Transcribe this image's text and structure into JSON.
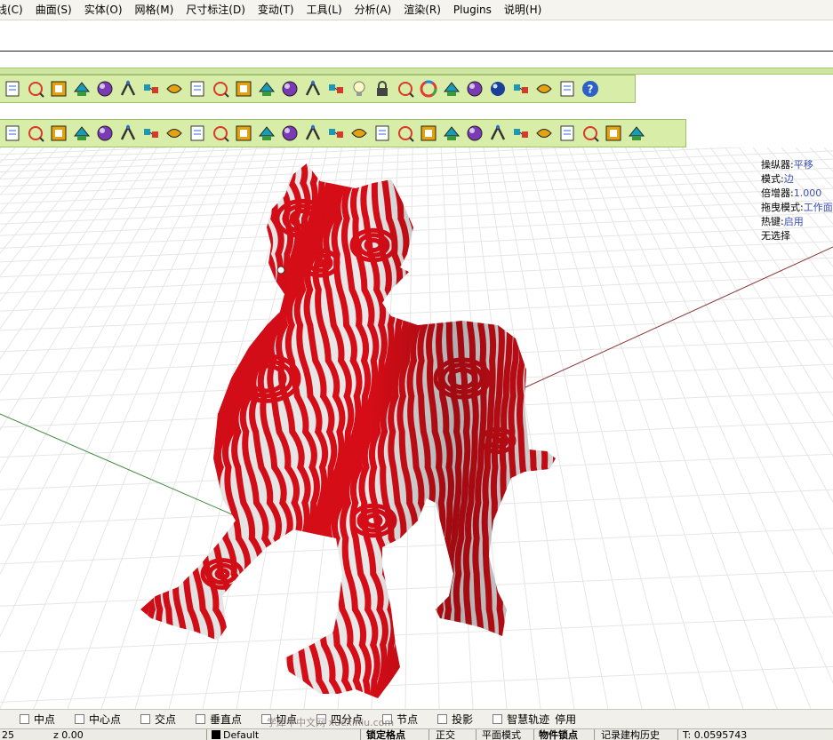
{
  "menu": [
    "线(C)",
    "曲面(S)",
    "实体(O)",
    "网格(M)",
    "尺寸标注(D)",
    "变动(T)",
    "工具(L)",
    "分析(A)",
    "渲染(R)",
    "Plugins",
    "说明(H)"
  ],
  "toolbar1_icons": [
    "document-icon",
    "clipboard-icon",
    "undo-icon",
    "pan-hand-icon",
    "rotate-view-icon",
    "zoom-icon",
    "zoom-window-icon",
    "zoom-extents-icon",
    "zoom-selected-icon",
    "undo-view-icon",
    "four-viewports-icon",
    "car-icon",
    "plane-icon",
    "cplane-icon",
    "origin-icon",
    "light-bulb-icon",
    "lock-icon",
    "layer-icon",
    "color-wheel-icon",
    "sphere-wire-icon",
    "render-sphere-icon",
    "render-ball-icon",
    "flag-icon",
    "gear-icon",
    "hierarchy-icon",
    "help-icon"
  ],
  "toolbar2_icons": [
    "array-icon",
    "grid-points-icon",
    "rotate-obj-icon",
    "polyhedron-icon",
    "flip-icon",
    "twist-icon",
    "arch-icon",
    "bend-icon",
    "extrude-icon",
    "box-split-icon",
    "grid-box-icon",
    "check-box-icon",
    "mirror-icon",
    "grid-x-icon",
    "grid-red-icon",
    "cube-edit-icon",
    "stairs-icon",
    "stairs2-icon",
    "cut-icon",
    "star-tool-icon",
    "surface-icon",
    "contour-icon",
    "flatten-icon",
    "cross-icon",
    "solid-icon",
    "dots-icon",
    "tree-icon",
    "spiral-icon"
  ],
  "osd": [
    {
      "label": "操纵器:",
      "value": "平移"
    },
    {
      "label": "模式:",
      "value": "边"
    },
    {
      "label": "倍增器:",
      "value": "1.000"
    },
    {
      "label": "拖曳模式:",
      "value": "工作面"
    },
    {
      "label": "热键:",
      "value": "启用"
    },
    {
      "label": "无选择",
      "value": ""
    }
  ],
  "osnap": [
    "中点",
    "中心点",
    "交点",
    "垂直点",
    "切点",
    "四分点",
    "节点",
    "投影",
    "智慧轨迹",
    "停用"
  ],
  "status": {
    "x": "25",
    "z": "z 0.00",
    "layer": "Default",
    "grid_snap": "锁定格点",
    "ortho": "正交",
    "planar": "平面模式",
    "osnap": "物件锁点",
    "history": "记录建构历史",
    "tolerance": "T: 0.0595743"
  },
  "watermark": "学犀牛中文网 xuexiniu.com",
  "colors": {
    "toolbar_bg": "#d8eda8",
    "model_red": "#d60d17",
    "model_white": "#e8e8e8",
    "osd_value": "#3a4fb5",
    "grid": "#e6e6e6",
    "x_axis": "#8a3a3a",
    "y_axis": "#3f8a3f"
  }
}
